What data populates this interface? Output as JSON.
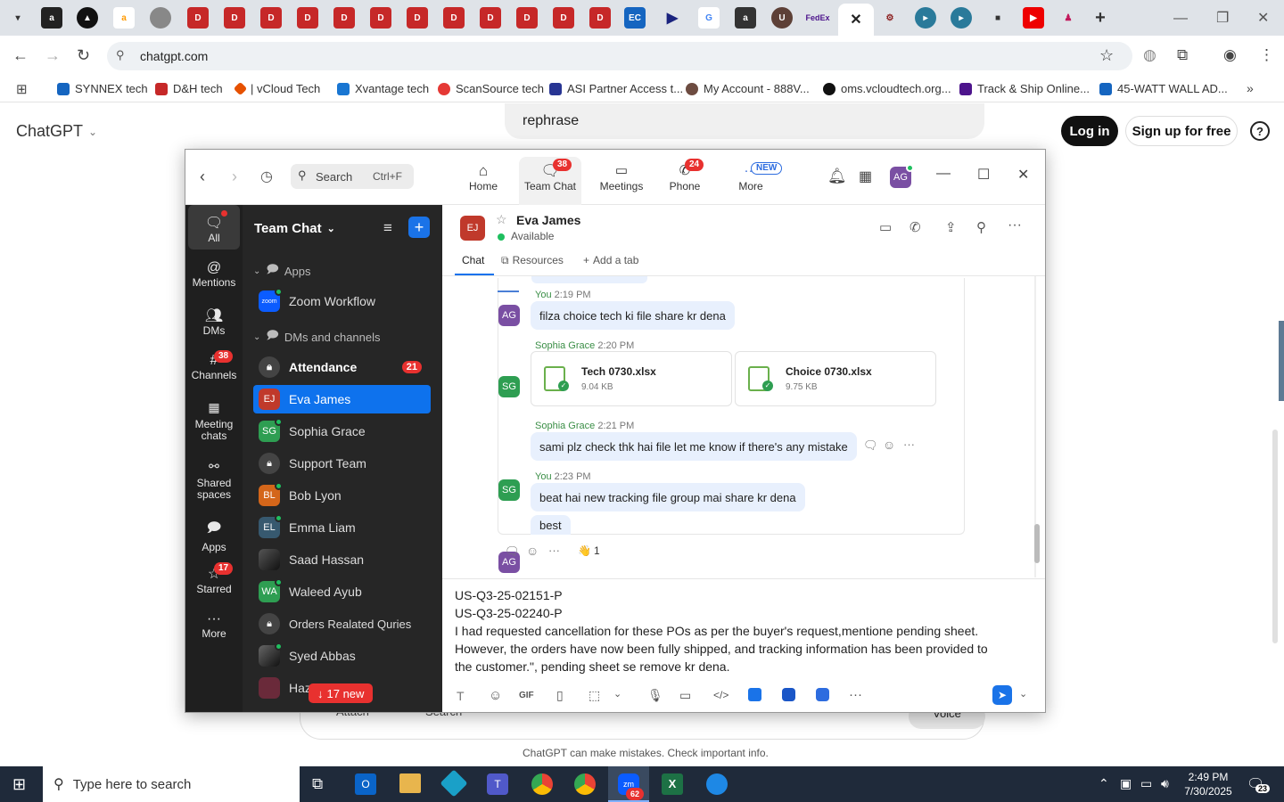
{
  "browser": {
    "url": "chatgpt.com",
    "bookmarks": [
      "SYNNEX tech",
      "D&H tech",
      "| vCloud Tech",
      "Xvantage tech",
      "ScanSource tech",
      "ASI Partner Access t...",
      "My Account - 888V...",
      "oms.vcloudtech.org...",
      "Track & Ship Online...",
      "45-WATT WALL AD..."
    ]
  },
  "chatgpt": {
    "brand": "ChatGPT",
    "prompt_text": "rephrase",
    "login": "Log in",
    "signup": "Sign up for free",
    "attach": "Attach",
    "search": "Search",
    "voice": "Voice",
    "disclaimer": "ChatGPT can make mistakes. Check important info."
  },
  "zoom": {
    "search_placeholder": "Search",
    "search_shortcut": "Ctrl+F",
    "nav": [
      {
        "label": "Home"
      },
      {
        "label": "Team Chat",
        "badge": "38"
      },
      {
        "label": "Meetings"
      },
      {
        "label": "Phone",
        "badge": "24"
      },
      {
        "label": "More",
        "badge": "NEW"
      }
    ],
    "avatar_initials": "AG",
    "rail": [
      {
        "label": "All"
      },
      {
        "label": "Mentions"
      },
      {
        "label": "DMs"
      },
      {
        "label": "Channels",
        "badge": "38"
      },
      {
        "label": "Meeting\nchats"
      },
      {
        "label": "Shared\nspaces"
      },
      {
        "label": "Apps"
      },
      {
        "label": "Starred",
        "badge": "17"
      },
      {
        "label": "More"
      }
    ],
    "list": {
      "title": "Team Chat",
      "section_apps": "Apps",
      "zoom_workflow": "Zoom Workflow",
      "section_dms": "DMs and channels",
      "attendance": "Attendance",
      "attendance_badge": "21",
      "contacts": [
        {
          "name": "Eva James",
          "initials": "EJ"
        },
        {
          "name": "Sophia Grace",
          "initials": "SG"
        },
        {
          "name": "Support Team",
          "initials": ""
        },
        {
          "name": "Bob Lyon",
          "initials": "BL"
        },
        {
          "name": "Emma Liam",
          "initials": "EL"
        },
        {
          "name": "Saad Hassan",
          "initials": ""
        },
        {
          "name": "Waleed Ayub",
          "initials": "WA"
        },
        {
          "name": "Orders Realated Quries",
          "initials": ""
        },
        {
          "name": "Syed Abbas",
          "initials": ""
        },
        {
          "name": "Haz",
          "initials": ""
        }
      ],
      "new_pill": "17 new"
    },
    "chat": {
      "contact": "Eva James",
      "contact_initials": "EJ",
      "status": "Available",
      "tabs": [
        "Chat",
        "Resources",
        "Add a tab"
      ],
      "messages": [
        {
          "sender": "You",
          "time": "2:19 PM",
          "initials": "AG",
          "text": "filza choice tech ki file share kr dena"
        },
        {
          "sender": "Sophia Grace",
          "time": "2:20 PM",
          "initials": "SG",
          "files": [
            {
              "name": "Tech 0730.xlsx",
              "size": "9.04 KB"
            },
            {
              "name": "Choice 0730.xlsx",
              "size": "9.75 KB"
            }
          ]
        },
        {
          "sender": "Sophia Grace",
          "time": "2:21 PM",
          "initials": "SG",
          "text": "sami plz check thk hai file let me know if there's any mistake"
        },
        {
          "sender": "You",
          "time": "2:23 PM",
          "initials": "AG",
          "text": "beat hai new tracking file group mai share kr dena"
        },
        {
          "text": "best"
        }
      ],
      "reaction_count": "1",
      "composer_lines": [
        "US-Q3-25-02151-P",
        "US-Q3-25-02240-P",
        "I had requested cancellation for these POs as per the buyer's request,mentione pending sheet.",
        "However, the orders have now been fully shipped, and tracking information has been provided to",
        "the customer.\", pending sheet se remove kr dena."
      ]
    }
  },
  "taskbar": {
    "search_placeholder": "Type here to search",
    "time": "2:49 PM",
    "date": "7/30/2025",
    "zoom_badge": "62",
    "notif_badge": "23"
  }
}
